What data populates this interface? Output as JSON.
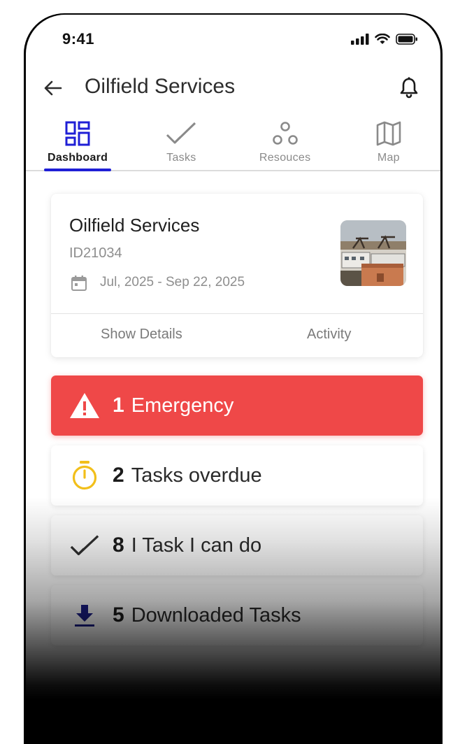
{
  "status_bar": {
    "time": "9:41"
  },
  "header": {
    "title": "Oilfield Services"
  },
  "tabs": [
    {
      "label": "Dashboard",
      "icon": "dashboard-icon",
      "active": true
    },
    {
      "label": "Tasks",
      "icon": "check-icon",
      "active": false
    },
    {
      "label": "Resouces",
      "icon": "resources-icon",
      "active": false
    },
    {
      "label": "Map",
      "icon": "map-icon",
      "active": false
    }
  ],
  "project": {
    "title": "Oilfield Services",
    "id": "ID21034",
    "dates": "Jul, 2025 - Sep 22, 2025",
    "show_details_label": "Show Details",
    "activity_label": "Activity"
  },
  "stats": [
    {
      "count": "1",
      "label": "Emergency",
      "icon": "warning-icon"
    },
    {
      "count": "2",
      "label": "Tasks overdue",
      "icon": "stopwatch-icon"
    },
    {
      "count": "8",
      "label": " I Task I can do",
      "icon": "check-icon"
    },
    {
      "count": "5",
      "label": "Downloaded Tasks",
      "icon": "download-icon"
    }
  ],
  "colors": {
    "accent": "#1f1fd6",
    "emergency": "#ef4848",
    "overdue_icon": "#f2bf1a",
    "download_icon": "#1c1f8a"
  }
}
